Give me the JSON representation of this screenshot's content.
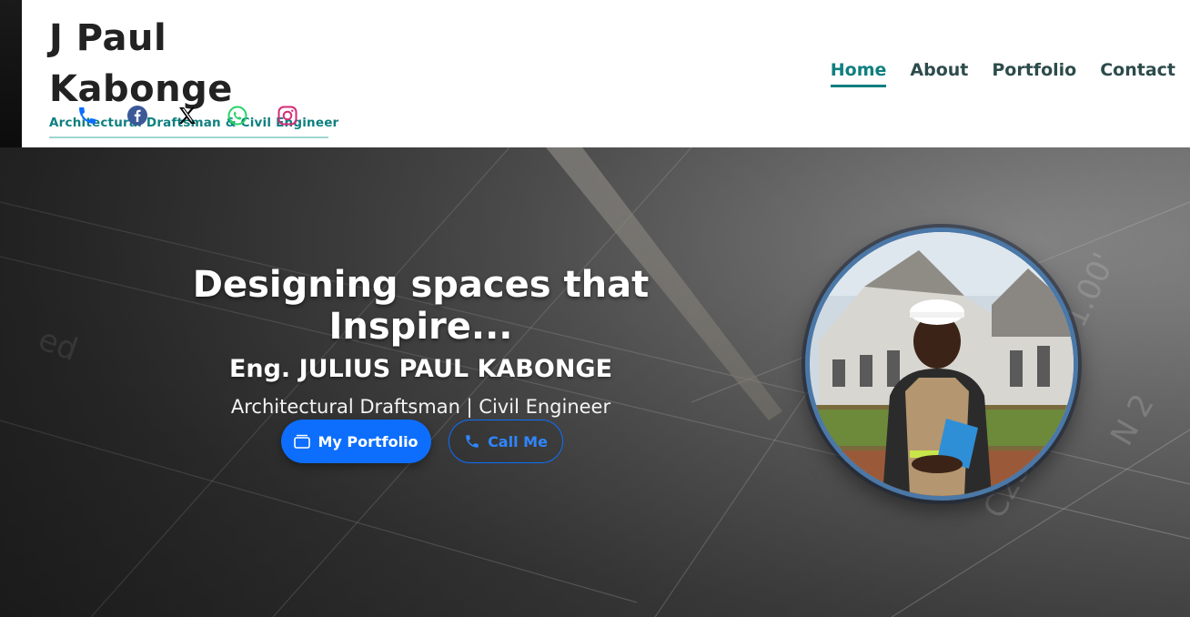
{
  "brand": {
    "title": "J Paul Kabonge",
    "subtitle": "Architectural Draftsman & Civil Engineer"
  },
  "socials": [
    {
      "icon": "phone-icon",
      "color": "#0d6efd"
    },
    {
      "icon": "facebook-icon",
      "color": "#3b5998"
    },
    {
      "icon": "x-icon",
      "color": "#000000"
    },
    {
      "icon": "whatsapp-icon",
      "color": "#25d366"
    },
    {
      "icon": "instagram-icon",
      "color": "#d62976"
    }
  ],
  "nav": {
    "home": "Home",
    "about": "About",
    "portfolio": "Portfolio",
    "contact": "Contact",
    "active": "Home"
  },
  "hero": {
    "headline": "Designing spaces that Inspire...",
    "name": "Eng. JULIUS PAUL KABONGE",
    "role": "Architectural Draftsman | Civil Engineer",
    "portfolio_button": "My Portfolio",
    "call_button": "Call Me",
    "portrait_icon": "portrait-photo"
  },
  "colors": {
    "accent": "#0f7f7f",
    "primary_button": "#0d6efd",
    "nav_text": "#2d4b4b"
  }
}
